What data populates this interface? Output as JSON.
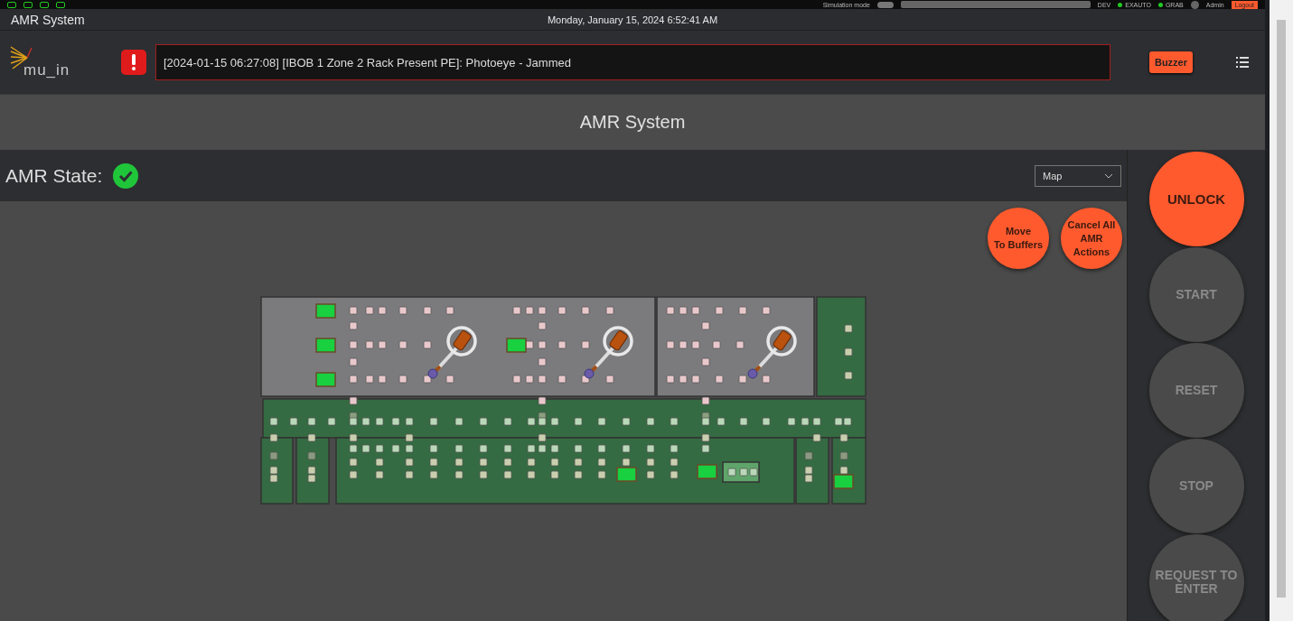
{
  "top_bar": {
    "simulation_mode": {
      "label": "Simulation mode",
      "on": false
    },
    "environment": "DEV",
    "indicators": [
      {
        "label": "EXAUTO",
        "on": true
      },
      {
        "label": "GRAB",
        "on": true
      }
    ],
    "user": "Admin",
    "logout": "Logout"
  },
  "title_bar": {
    "title": "AMR System",
    "datetime": "Monday, January 15, 2024 6:52:41 AM"
  },
  "header": {
    "logo": "mu_in",
    "alert": {
      "message": "[2024-01-15 06:27:08] [IBOB 1 Zone 2 Rack Present PE]: Photoeye - Jammed"
    },
    "buzzer": "Buzzer"
  },
  "page_title": "AMR System",
  "state": {
    "label": "AMR State:",
    "ok": true
  },
  "view_select": {
    "value": "Map"
  },
  "map_actions": [
    {
      "label": "Move\nTo Buffers"
    },
    {
      "label": "Cancel All\nAMR\nActions"
    }
  ],
  "controls": [
    {
      "label": "UNLOCK",
      "disabled": false
    },
    {
      "label": "START",
      "disabled": true
    },
    {
      "label": "RESET",
      "disabled": true
    },
    {
      "label": "STOP",
      "disabled": true
    },
    {
      "label": "REQUEST TO\nENTER",
      "disabled": true
    }
  ]
}
